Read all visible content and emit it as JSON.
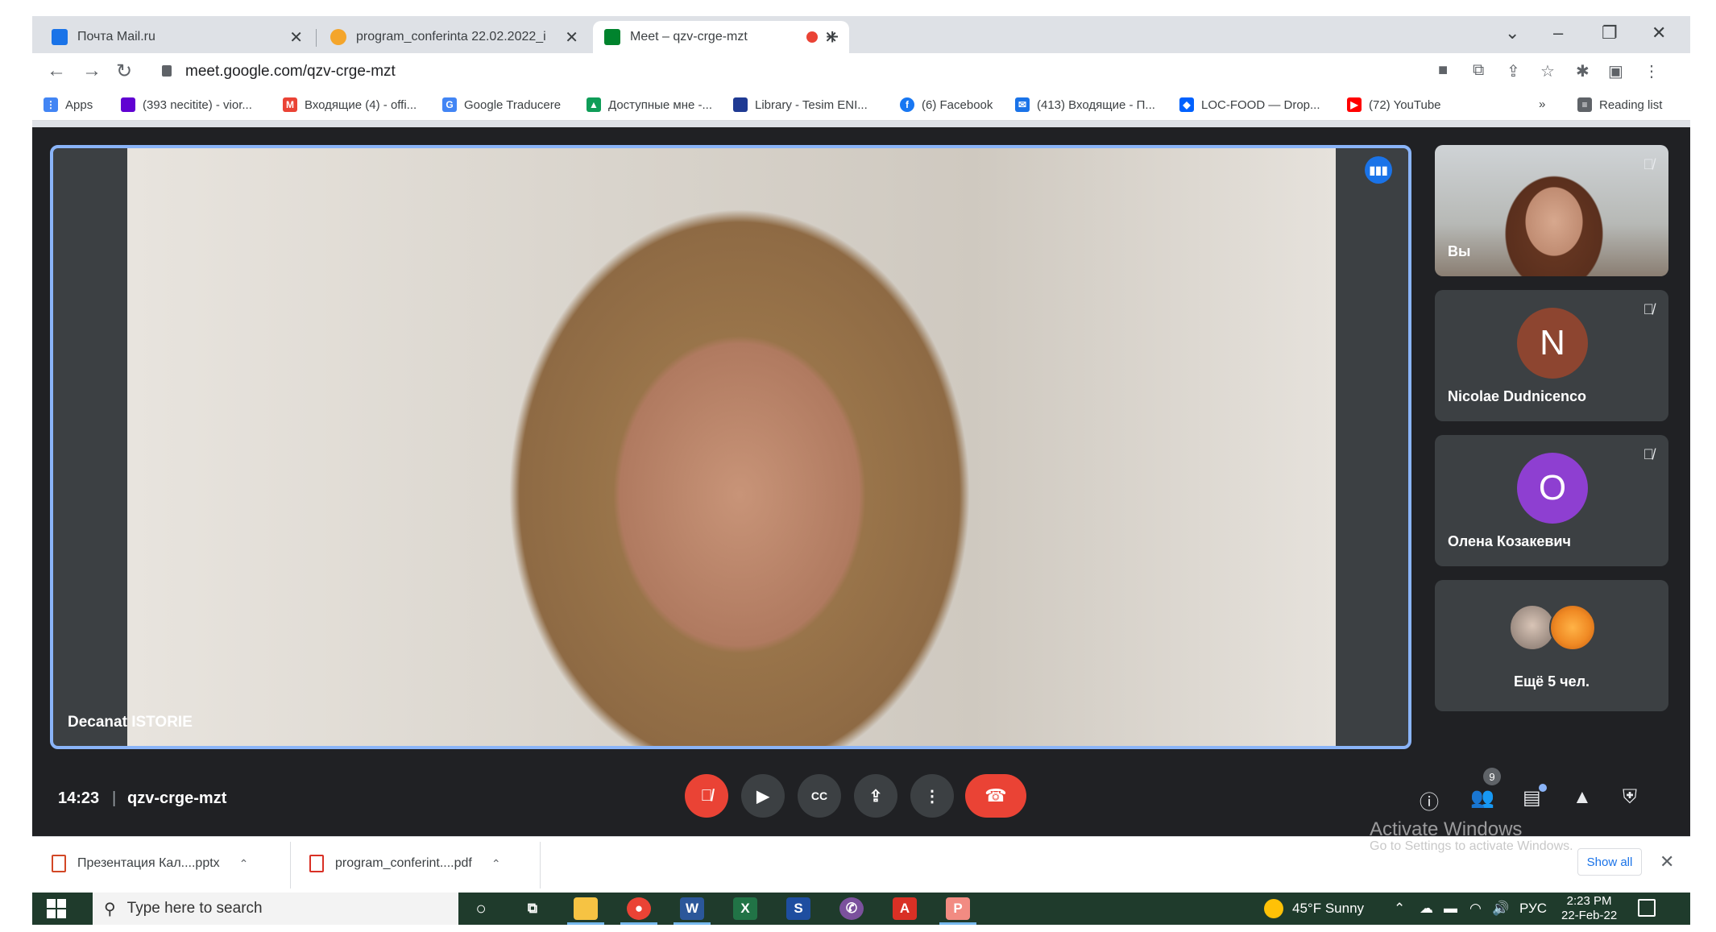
{
  "tabs": [
    {
      "title": "Почта Mail.ru",
      "favicon": "mail-ru-icon",
      "color": "#1a73e8",
      "active": false
    },
    {
      "title": "program_conferinta 22.02.2022_i",
      "favicon": "pdf-doc-icon",
      "color": "#f4a52b",
      "active": false
    },
    {
      "title": "Meet – qzv-crge-mzt",
      "favicon": "google-meet-icon",
      "color": "#00832d",
      "active": true
    }
  ],
  "address": {
    "url": "meet.google.com/qzv-crge-mzt"
  },
  "bookmarks": {
    "apps": "Apps",
    "items": [
      {
        "label": "(393 necitite) - vior...",
        "icon": "yahoo-mail-icon",
        "color": "#6001d2"
      },
      {
        "label": "Входящие (4) - offi...",
        "icon": "gmail-icon",
        "color": "#ea4335"
      },
      {
        "label": "Google Traducere",
        "icon": "google-translate-icon",
        "color": "#4285f4"
      },
      {
        "label": "Доступные мне -...",
        "icon": "google-drive-icon",
        "color": "#0f9d58"
      },
      {
        "label": "Library - Tesim ENI...",
        "icon": "library-icon",
        "color": "#1f3a93"
      },
      {
        "label": "(6) Facebook",
        "icon": "facebook-icon",
        "color": "#1877f2"
      },
      {
        "label": "(413) Входящие - П...",
        "icon": "mail-icon",
        "color": "#1a73e8"
      },
      {
        "label": "LOC-FOOD — Drop...",
        "icon": "dropbox-icon",
        "color": "#0061fe"
      },
      {
        "label": "(72) YouTube",
        "icon": "youtube-icon",
        "color": "#ff0000"
      }
    ],
    "more": "»",
    "reading_list": "Reading list"
  },
  "meet": {
    "main_speaker": "Decanat ISTORIE",
    "self_label": "Вы",
    "participants": [
      {
        "name": "Nicolae Dudnicenco",
        "initial": "N",
        "color": "#8d4530"
      },
      {
        "name": "Олена Козакевич",
        "initial": "О",
        "color": "#8e3fd1"
      }
    ],
    "more_label": "Ещё 5 чел.",
    "time": "14:23",
    "separator": "|",
    "code": "qzv-crge-mzt",
    "people_count": "9"
  },
  "activation": {
    "title": "Activate Windows",
    "subtitle": "Go to Settings to activate Windows."
  },
  "downloads": {
    "items": [
      {
        "name": "Презентация Кал....pptx",
        "icon": "pptx-file-icon",
        "color": "#d24726"
      },
      {
        "name": "program_conferint....pdf",
        "icon": "pdf-file-icon",
        "color": "#d93025"
      }
    ],
    "show_all": "Show all"
  },
  "taskbar": {
    "search_placeholder": "Type here to search",
    "weather": "45°F  Sunny",
    "language": "РУС",
    "time": "2:23 PM",
    "date": "22-Feb-22"
  }
}
